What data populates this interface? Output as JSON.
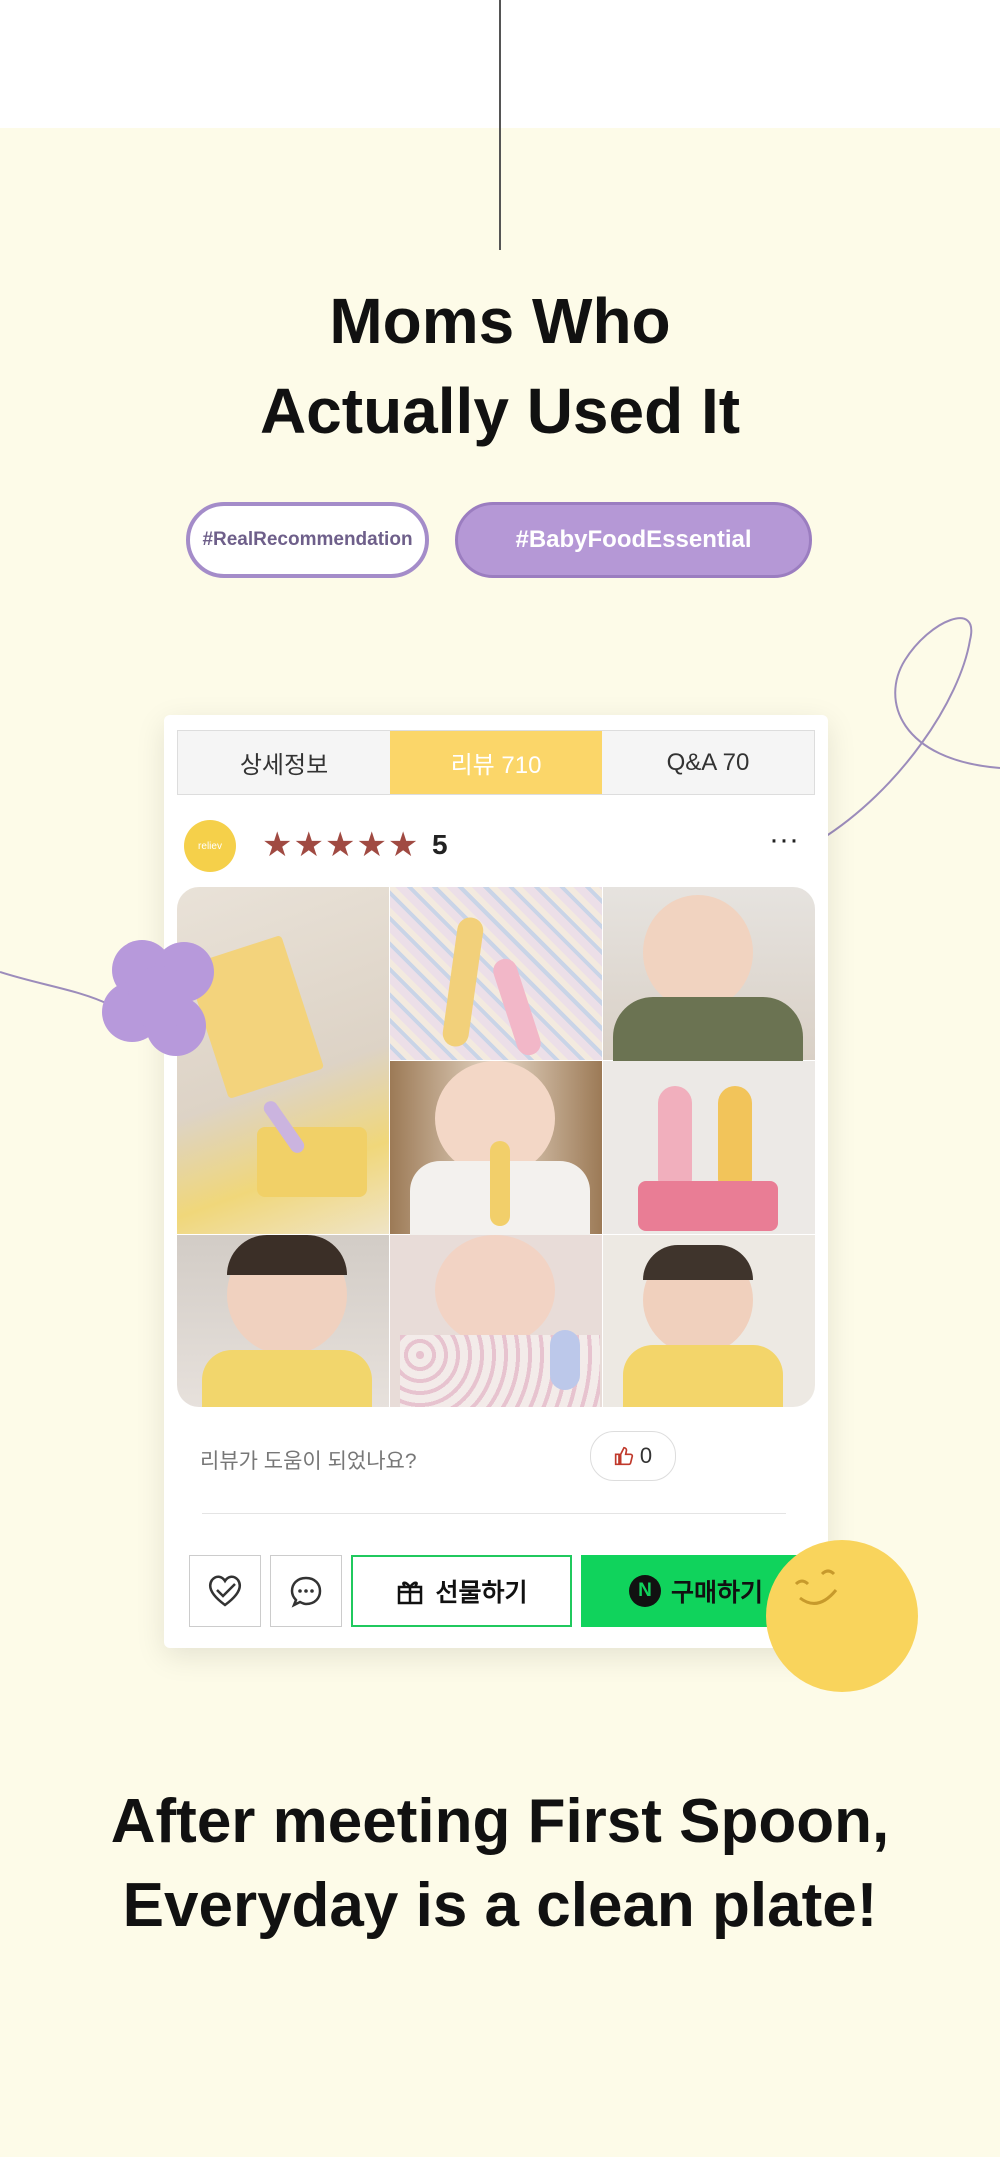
{
  "headline": {
    "line1": "Moms Who",
    "line2": "Actually Used It"
  },
  "tags": [
    "#RealRecommendation",
    "#BabyFoodEssential"
  ],
  "tabs": [
    {
      "label": "상세정보",
      "active": false
    },
    {
      "label": "리뷰  710",
      "active": true
    },
    {
      "label": "Q&A  70",
      "active": false
    }
  ],
  "review": {
    "avatar_text": "reliev",
    "stars": "★★★★★",
    "rating": "5",
    "more": "···",
    "helpful_prompt": "리뷰가 도움이 되었나요?",
    "like_count": "0"
  },
  "photos": [
    "product-box-and-pouch",
    "spoons-on-cloth",
    "baby-with-spoon",
    "baby-holding-spoon",
    "spoons-in-stand",
    "toddler-with-spoon",
    "baby-in-floral",
    "baby-eating"
  ],
  "actions": {
    "gift_label": "선물하기",
    "buy_label": "구매하기",
    "buy_logo": "N"
  },
  "footer": {
    "line1": "After meeting First Spoon,",
    "line2": "Everyday is a clean plate!"
  },
  "colors": {
    "background": "#fdfbe8",
    "accent_yellow": "#fbd669",
    "purple": "#b598d6",
    "naver_green": "#10d35c",
    "star": "#a04a42"
  }
}
